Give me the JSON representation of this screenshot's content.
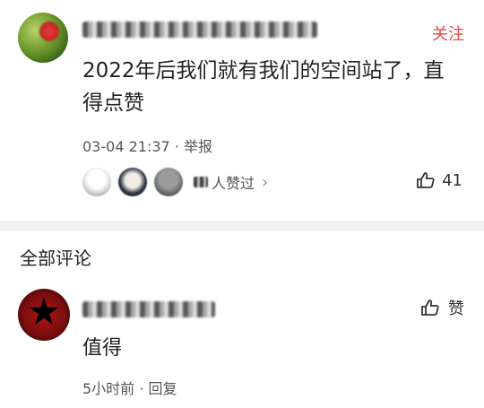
{
  "post": {
    "username_masked": "",
    "follow_label": "关注",
    "content": "2022年后我们就有我们的空间站了，直得点赞",
    "time": "03-04 21:37",
    "report_label": "举报",
    "likers_text": "人赞过",
    "likers_chevron": "›",
    "like_count": "41"
  },
  "comments": {
    "section_title": "全部评论",
    "items": [
      {
        "username_masked": "",
        "text": "值得",
        "time": "5小时前",
        "reply_label": "回复",
        "like_label": "赞"
      }
    ]
  },
  "colors": {
    "accent": "#e04a4a",
    "divider": "#f2f2f2",
    "text": "#222222",
    "meta": "#555555"
  },
  "icons": {
    "thumb": "thumbs-up-icon",
    "chevron": "chevron-right-icon"
  }
}
